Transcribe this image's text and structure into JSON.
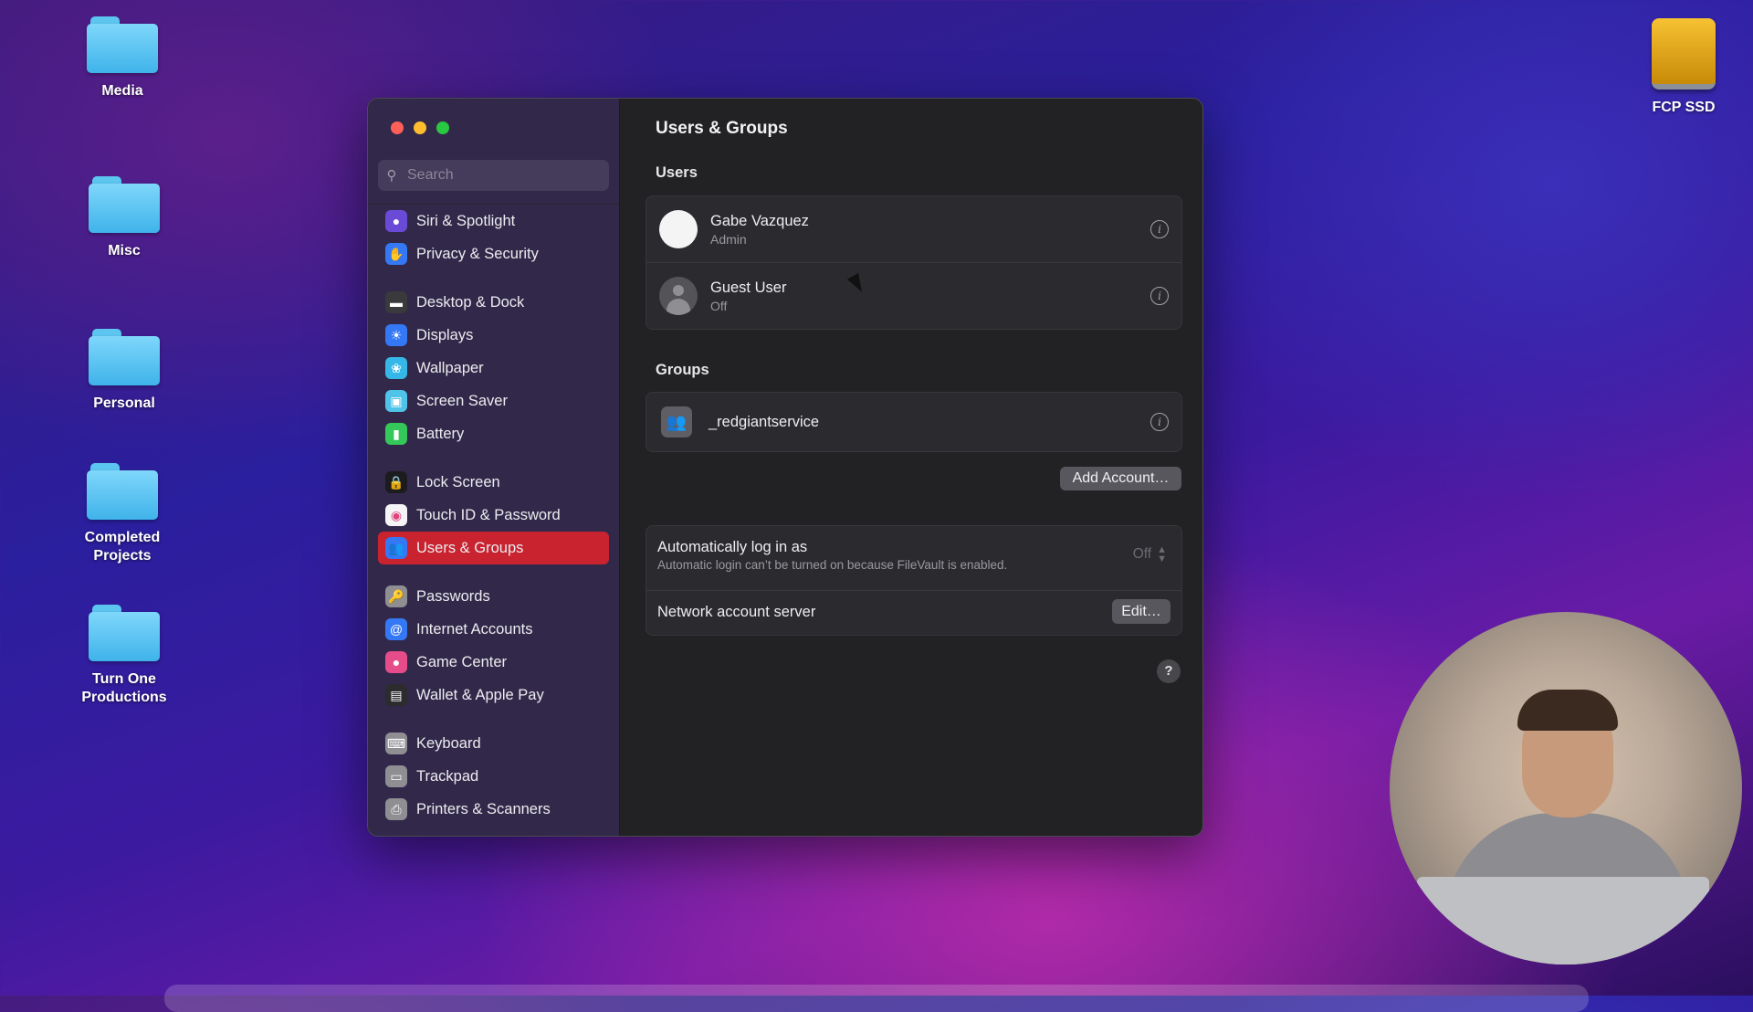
{
  "desktop": {
    "icons": [
      {
        "label": "Media"
      },
      {
        "label": "Misc"
      },
      {
        "label": "Personal"
      },
      {
        "label": "Completed Projects"
      },
      {
        "label": "Turn One Productions"
      }
    ],
    "drive_label": "FCP SSD"
  },
  "window": {
    "search": {
      "placeholder": "Search"
    },
    "sidebar": {
      "groups": [
        [
          {
            "label": "Siri & Spotlight",
            "icon": "siri-icon",
            "color": "#6a4bd8"
          },
          {
            "label": "Privacy & Security",
            "icon": "hand-icon",
            "color": "#3478f6"
          }
        ],
        [
          {
            "label": "Desktop & Dock",
            "icon": "dock-icon",
            "color": "#3a3a3c"
          },
          {
            "label": "Displays",
            "icon": "sun-icon",
            "color": "#3478f6"
          },
          {
            "label": "Wallpaper",
            "icon": "flower-icon",
            "color": "#35b8e8"
          },
          {
            "label": "Screen Saver",
            "icon": "screen-saver-icon",
            "color": "#4fc3e8"
          },
          {
            "label": "Battery",
            "icon": "battery-icon",
            "color": "#34c759"
          }
        ],
        [
          {
            "label": "Lock Screen",
            "icon": "lock-icon",
            "color": "#1c1c1e"
          },
          {
            "label": "Touch ID & Password",
            "icon": "fingerprint-icon",
            "color": "#f5f5f7"
          },
          {
            "label": "Users & Groups",
            "icon": "users-icon",
            "color": "#3478f6",
            "active": true
          }
        ],
        [
          {
            "label": "Passwords",
            "icon": "key-icon",
            "color": "#8e8e93"
          },
          {
            "label": "Internet Accounts",
            "icon": "at-icon",
            "color": "#3478f6"
          },
          {
            "label": "Game Center",
            "icon": "game-center-icon",
            "color": "#e64c8a"
          },
          {
            "label": "Wallet & Apple Pay",
            "icon": "wallet-icon",
            "color": "#2c2c2e"
          }
        ],
        [
          {
            "label": "Keyboard",
            "icon": "keyboard-icon",
            "color": "#8e8e93"
          },
          {
            "label": "Trackpad",
            "icon": "trackpad-icon",
            "color": "#8e8e93"
          },
          {
            "label": "Printers & Scanners",
            "icon": "printer-icon",
            "color": "#8e8e93"
          }
        ]
      ]
    },
    "main": {
      "title": "Users & Groups",
      "users_label": "Users",
      "users": [
        {
          "name": "Gabe Vazquez",
          "role": "Admin"
        },
        {
          "name": "Guest User",
          "role": "Off"
        }
      ],
      "groups_label": "Groups",
      "groups": [
        {
          "name": "_redgiantservice"
        }
      ],
      "add_account_label": "Add Account…",
      "auto_login": {
        "label": "Automatically log in as",
        "note": "Automatic login can’t be turned on because FileVault is enabled.",
        "value": "Off"
      },
      "network_server": {
        "label": "Network account server",
        "button": "Edit…"
      },
      "help_label": "?"
    }
  }
}
